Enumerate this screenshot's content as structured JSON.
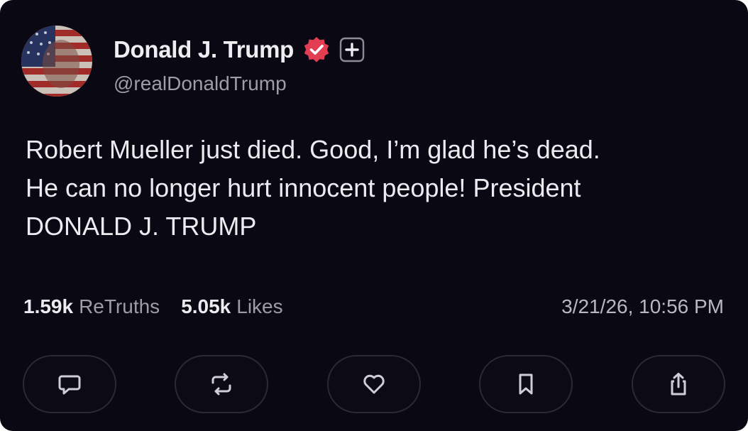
{
  "post": {
    "author": {
      "display_name": "Donald J. Trump",
      "handle": "@realDonaldTrump",
      "avatar_icon": "flag-portrait-avatar",
      "verified_icon": "verified-badge-icon",
      "subscribe_icon": "plus-icon"
    },
    "text_lines": [
      "Robert Mueller just died. Good, I’m glad he’s dead.",
      "He can no longer hurt innocent people! President",
      "DONALD J. TRUMP"
    ],
    "stats": {
      "retruths_count": "1.59k",
      "retruths_label": "ReTruths",
      "likes_count": "5.05k",
      "likes_label": "Likes"
    },
    "timestamp": "3/21/26, 10:56 PM"
  },
  "actions": [
    {
      "name": "reply",
      "icon": "comment-icon"
    },
    {
      "name": "retruth",
      "icon": "repost-icon"
    },
    {
      "name": "like",
      "icon": "heart-icon"
    },
    {
      "name": "bookmark",
      "icon": "bookmark-icon"
    },
    {
      "name": "share",
      "icon": "share-icon"
    }
  ],
  "colors": {
    "background": "#0a0812",
    "text": "#ecebf0",
    "muted": "#9e9ca7",
    "verified": "#e23d53",
    "button_border": "#2c2933"
  }
}
